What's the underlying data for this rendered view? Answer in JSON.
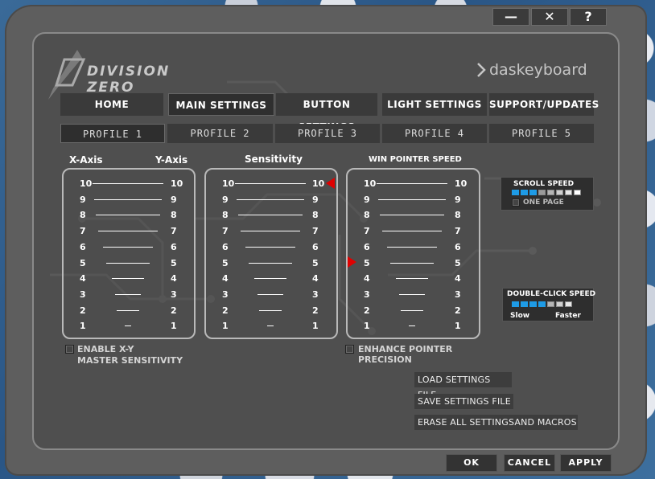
{
  "window": {
    "minimize_symbol": "—",
    "close_symbol": "✕",
    "help_symbol": "?"
  },
  "branding": {
    "product": "DIVISION ZERO",
    "company": "daskeyboard"
  },
  "nav_tabs": [
    {
      "label": "HOME",
      "active": false
    },
    {
      "label": "MAIN SETTINGS",
      "active": true
    },
    {
      "label": "BUTTON SETTINGS",
      "active": false
    },
    {
      "label": "LIGHT SETTINGS",
      "active": false
    },
    {
      "label": "SUPPORT/UPDATES",
      "active": false
    }
  ],
  "profiles": [
    {
      "label": "PROFILE 1",
      "active": true
    },
    {
      "label": "PROFILE 2",
      "active": false
    },
    {
      "label": "PROFILE 3",
      "active": false
    },
    {
      "label": "PROFILE 4",
      "active": false
    },
    {
      "label": "PROFILE 5",
      "active": false
    }
  ],
  "xy_panel": {
    "x_header": "X-Axis",
    "y_header": "Y-Axis",
    "levels": [
      "10",
      "9",
      "8",
      "7",
      "6",
      "5",
      "4",
      "3",
      "2",
      "1"
    ]
  },
  "sensitivity_panel": {
    "header": "Sensitivity",
    "levels": [
      "10",
      "9",
      "8",
      "7",
      "6",
      "5",
      "4",
      "3",
      "2",
      "1"
    ],
    "selected_level": 10
  },
  "pointer_panel": {
    "header": "WIN POINTER SPEED",
    "levels": [
      "10",
      "9",
      "8",
      "7",
      "6",
      "5",
      "4",
      "3",
      "2",
      "1"
    ],
    "selected_level": 5
  },
  "options": {
    "xy_master_line1": "ENABLE X-Y",
    "xy_master_line2": "MASTER SENSITIVITY",
    "xy_master_checked": false,
    "enhance_line1": "ENHANCE POINTER",
    "enhance_line2": "PRECISION",
    "enhance_checked": false
  },
  "scroll_speed": {
    "title": "SCROLL SPEED",
    "level": 3,
    "segments": 8,
    "one_page_label": "ONE PAGE",
    "one_page_checked": false
  },
  "double_click": {
    "title": "DOUBLE-CLICK SPEED",
    "level": 4,
    "segments": 7,
    "slow_label": "Slow",
    "fast_label": "Faster"
  },
  "actions": {
    "load": "LOAD SETTINGS FILE",
    "save": "SAVE  SETTINGS FILE",
    "erase": "ERASE ALL SETTINGSAND MACROS"
  },
  "footer": {
    "ok": "OK",
    "cancel": "CANCEL",
    "apply": "APPLY"
  },
  "colors": {
    "accent_blue": "#1e9be6",
    "marker_red": "#e00000"
  }
}
